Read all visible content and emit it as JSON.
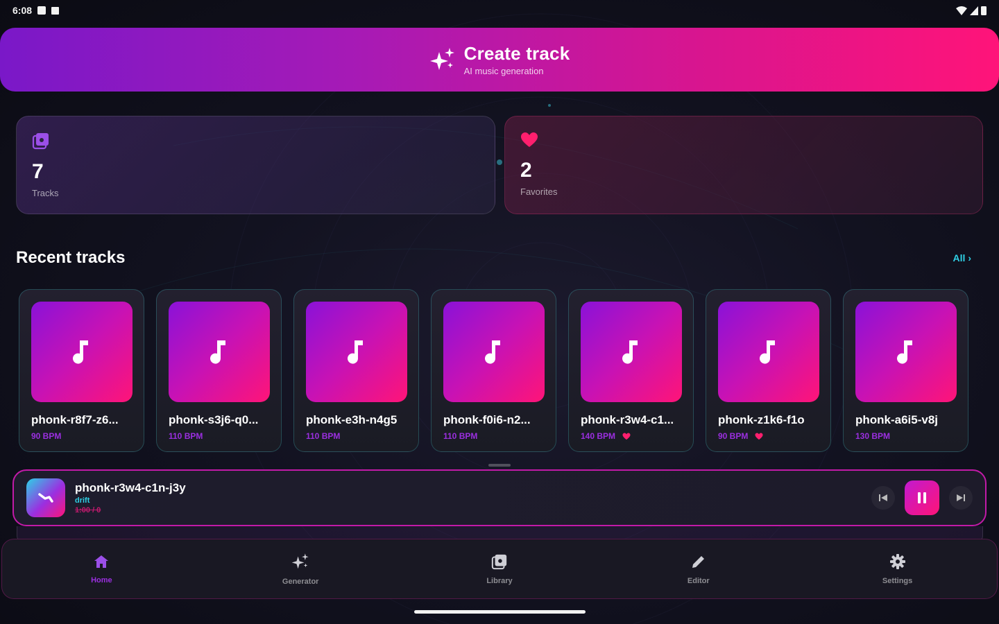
{
  "status_bar": {
    "time": "6:08"
  },
  "create_banner": {
    "title": "Create track",
    "subtitle": "AI music generation",
    "icon": "sparkles-icon"
  },
  "stats": {
    "tracks": {
      "value": "7",
      "label": "Tracks",
      "icon": "library-icon"
    },
    "favorites": {
      "value": "2",
      "label": "Favorites",
      "icon": "heart-icon"
    }
  },
  "recent": {
    "title": "Recent tracks",
    "see_all": "All ›",
    "items": [
      {
        "name": "phonk-r8f7-z6...",
        "bpm": "90 BPM",
        "favorite": false
      },
      {
        "name": "phonk-s3j6-q0...",
        "bpm": "110 BPM",
        "favorite": false
      },
      {
        "name": "phonk-e3h-n4g5",
        "bpm": "110 BPM",
        "favorite": false
      },
      {
        "name": "phonk-f0i6-n2...",
        "bpm": "110 BPM",
        "favorite": false
      },
      {
        "name": "phonk-r3w4-c1...",
        "bpm": "140 BPM",
        "favorite": true
      },
      {
        "name": "phonk-z1k6-f1o",
        "bpm": "90 BPM",
        "favorite": true
      },
      {
        "name": "phonk-a6i5-v8j",
        "bpm": "130 BPM",
        "favorite": false
      }
    ]
  },
  "player": {
    "title": "phonk-r3w4-c1n-j3y",
    "genre": "drift",
    "time": "1:00 / 0"
  },
  "nav": {
    "items": [
      {
        "label": "Home",
        "icon": "home-icon",
        "active": true
      },
      {
        "label": "Generator",
        "icon": "sparkles-icon",
        "active": false
      },
      {
        "label": "Library",
        "icon": "library-icon",
        "active": false
      },
      {
        "label": "Editor",
        "icon": "pencil-icon",
        "active": false
      },
      {
        "label": "Settings",
        "icon": "gear-icon",
        "active": false
      }
    ]
  },
  "colors": {
    "accent_purple": "#9b2fe0",
    "accent_pink": "#ff1477",
    "accent_cyan": "#2fd1e6",
    "background": "#121220"
  }
}
